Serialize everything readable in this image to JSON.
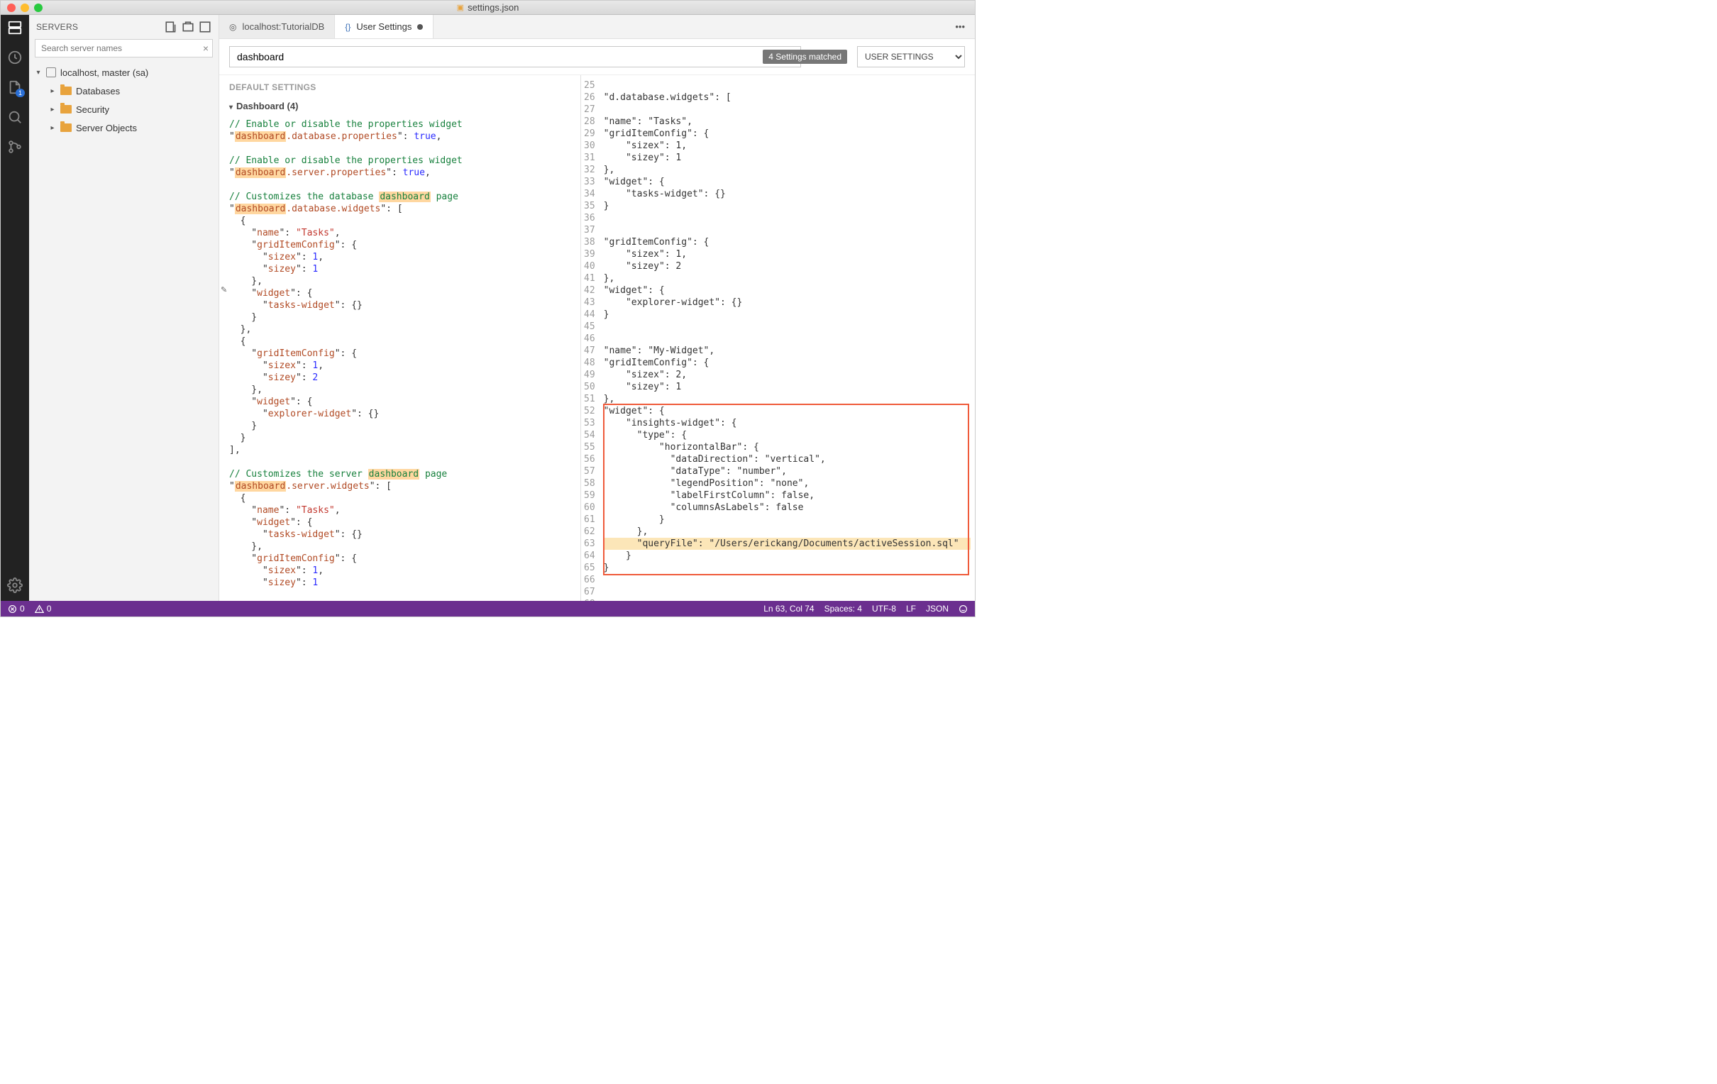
{
  "title": "settings.json",
  "sidebar": {
    "title": "SERVERS",
    "search_placeholder": "Search server names",
    "root": "localhost, master (sa)",
    "items": [
      "Databases",
      "Security",
      "Server Objects"
    ]
  },
  "tabs": [
    {
      "label": "localhost:TutorialDB",
      "icon": "globe-icon"
    },
    {
      "label": "User Settings",
      "icon": "braces-icon",
      "active": true,
      "dirty": true
    }
  ],
  "search": {
    "value": "dashboard",
    "matched": "4 Settings matched",
    "scope": "USER SETTINGS"
  },
  "left": {
    "section": "DEFAULT SETTINGS",
    "group": "Dashboard (4)"
  },
  "left_code": "// Enable or disable the properties widget\n\"dashboard.database.properties\": true,\n\n// Enable or disable the properties widget\n\"dashboard.server.properties\": true,\n\n// Customizes the database dashboard page\n\"dashboard.database.widgets\": [\n  {\n    \"name\": \"Tasks\",\n    \"gridItemConfig\": {\n      \"sizex\": 1,\n      \"sizey\": 1\n    },\n    \"widget\": {\n      \"tasks-widget\": {}\n    }\n  },\n  {\n    \"gridItemConfig\": {\n      \"sizex\": 1,\n      \"sizey\": 2\n    },\n    \"widget\": {\n      \"explorer-widget\": {}\n    }\n  }\n],\n\n// Customizes the server dashboard page\n\"dashboard.server.widgets\": [\n  {\n    \"name\": \"Tasks\",\n    \"widget\": {\n      \"tasks-widget\": {}\n    },\n    \"gridItemConfig\": {\n      \"sizex\": 1,\n      \"sizey\": 1",
  "right_start": 25,
  "right_lines": [
    "",
    "\"d.database.widgets\": [",
    "",
    "\"name\": \"Tasks\",",
    "\"gridItemConfig\": {",
    "    \"sizex\": 1,",
    "    \"sizey\": 1",
    "},",
    "\"widget\": {",
    "    \"tasks-widget\": {}",
    "}",
    "",
    "",
    "\"gridItemConfig\": {",
    "    \"sizex\": 1,",
    "    \"sizey\": 2",
    "},",
    "\"widget\": {",
    "    \"explorer-widget\": {}",
    "}",
    "",
    "",
    "\"name\": \"My-Widget\",",
    "\"gridItemConfig\": {",
    "    \"sizex\": 2,",
    "    \"sizey\": 1",
    "},",
    "\"widget\": {",
    "    \"insights-widget\": {",
    "      \"type\": {",
    "          \"horizontalBar\": {",
    "            \"dataDirection\": \"vertical\",",
    "            \"dataType\": \"number\",",
    "            \"legendPosition\": \"none\",",
    "            \"labelFirstColumn\": false,",
    "            \"columnsAsLabels\": false",
    "          }",
    "      },",
    "      \"queryFile\": \"/Users/erickang/Documents/activeSession.sql\"",
    "    }",
    "}",
    "",
    "",
    ""
  ],
  "status": {
    "errors": "0",
    "warnings": "0",
    "lncol": "Ln 63, Col 74",
    "spaces": "Spaces: 4",
    "encoding": "UTF-8",
    "eol": "LF",
    "lang": "JSON"
  }
}
